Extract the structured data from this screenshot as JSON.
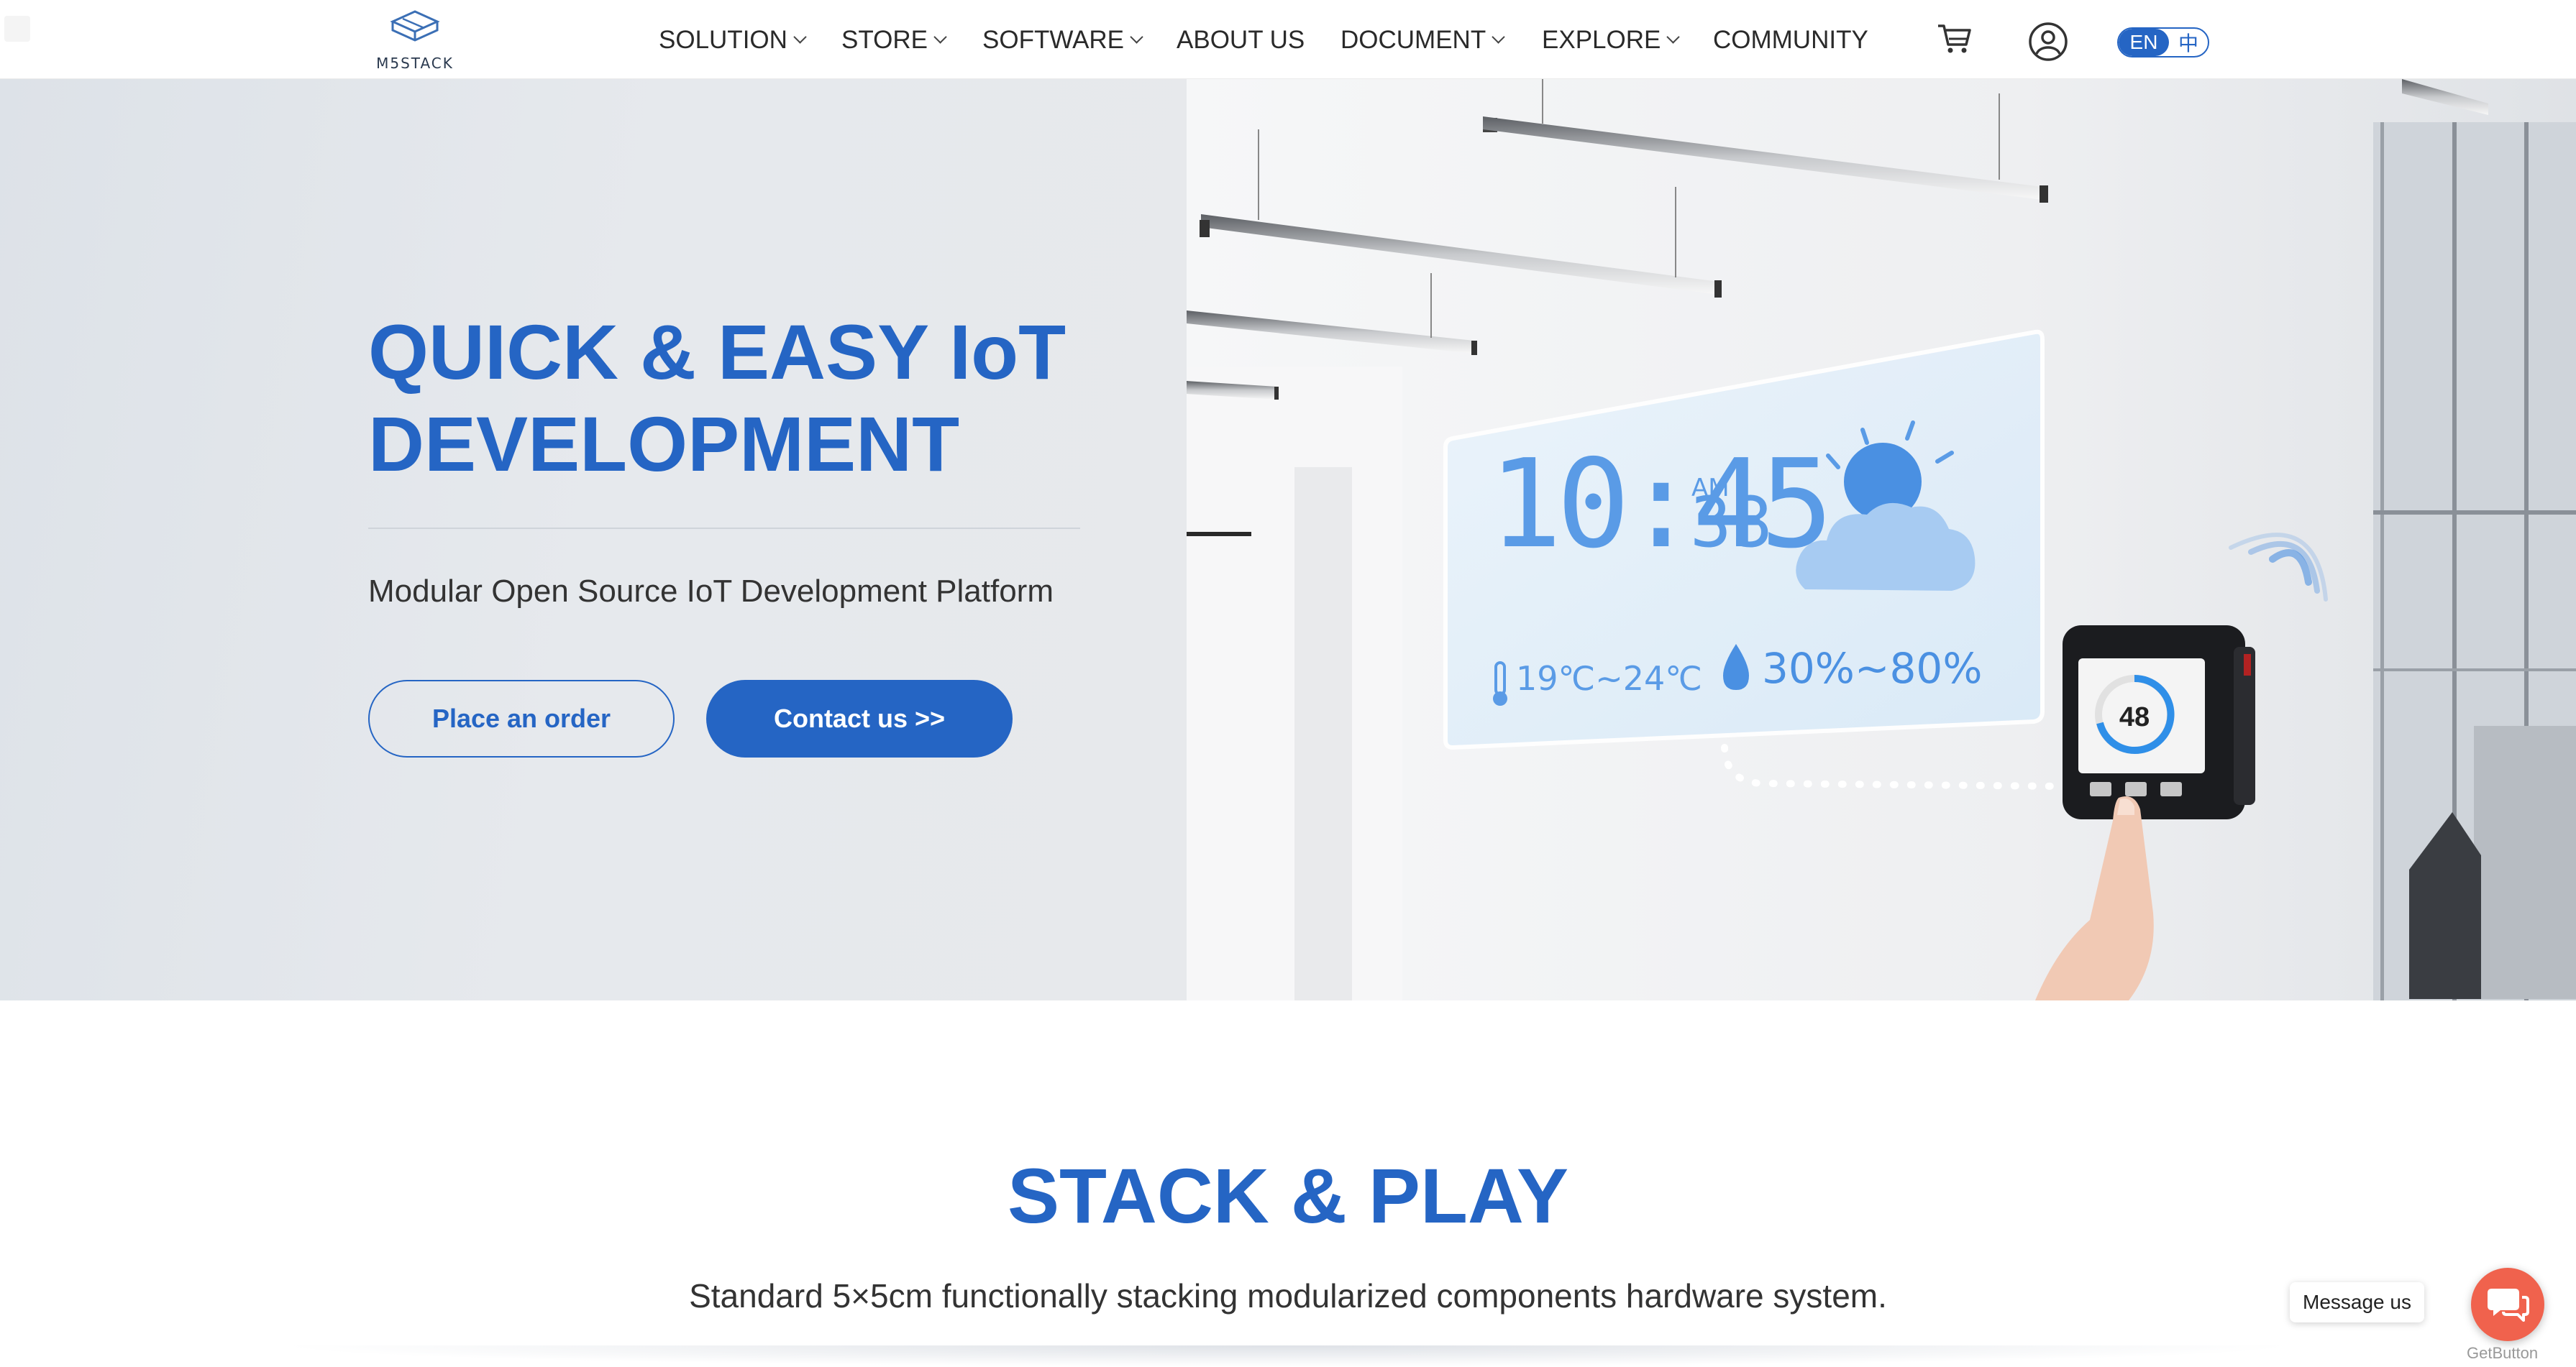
{
  "brand": {
    "logo_text": "M5STACK"
  },
  "nav": {
    "items": [
      {
        "label": "SOLUTION",
        "dropdown": true
      },
      {
        "label": "STORE",
        "dropdown": true
      },
      {
        "label": "SOFTWARE",
        "dropdown": true
      },
      {
        "label": "ABOUT US",
        "dropdown": false
      },
      {
        "label": "DOCUMENT",
        "dropdown": true
      },
      {
        "label": "EXPLORE",
        "dropdown": true
      },
      {
        "label": "COMMUNITY",
        "dropdown": false
      }
    ],
    "icons": [
      "cart-icon",
      "user-account-icon"
    ],
    "language": {
      "active": "EN",
      "alternate": "中"
    }
  },
  "hero": {
    "title_line1": "QUICK & EASY IoT",
    "title_line2": "DEVELOPMENT",
    "subtitle": "Modular Open Source IoT Development Platform",
    "primary_button": "Contact us >>",
    "secondary_button": "Place an order",
    "display_panel": {
      "time": "10:45",
      "ampm": "AM",
      "seconds": "33",
      "temperature": "19℃~24℃",
      "humidity": "30%~80%",
      "device_reading": "48"
    }
  },
  "stack_section": {
    "title": "STACK & PLAY",
    "subtitle": "Standard 5×5cm functionally stacking modularized components hardware system."
  },
  "chat_widget": {
    "message_label": "Message us",
    "provider": "GetButton"
  },
  "colors": {
    "brand_blue": "#2565c4",
    "chat_orange": "#f0624d",
    "text_dark": "#2a2a2a"
  }
}
